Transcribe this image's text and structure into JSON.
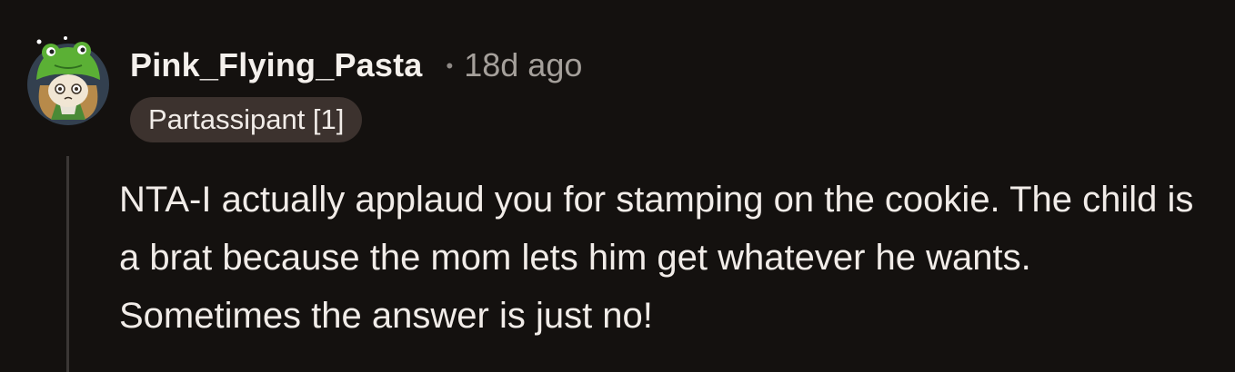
{
  "comment": {
    "author": "Pink_Flying_Pasta",
    "separator": "•",
    "timestamp": "18d ago",
    "flair": "Partassipant [1]",
    "body": "NTA-I actually applaud you for stamping on the cookie. The child is a brat because the mom lets him get whatever he wants. Sometimes the answer is just no!"
  },
  "avatar": {
    "icon": "frog-hat-character-avatar",
    "background": "#33404f",
    "hat_color": "#5bb035",
    "hair_color": "#b78a4a"
  },
  "colors": {
    "page_background": "#14110f",
    "flair_background": "#3c322e",
    "text": "#f1ece8",
    "meta_text": "#a5a09b",
    "thread_line": "#3b3735"
  }
}
